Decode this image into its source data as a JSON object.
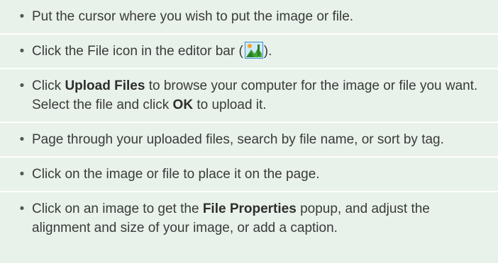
{
  "bullet_char": "•",
  "instructions": [
    {
      "text": "Put the cursor where you wish to put the image or file."
    },
    {
      "before": "Click the File icon in the editor bar (",
      "icon": "image-file-icon",
      "after": ")."
    },
    {
      "pre": "Click ",
      "bold1": "Upload Files",
      "mid": " to browse your computer for the image or file you want. Select the file and click ",
      "bold2": "OK",
      "post": " to upload it."
    },
    {
      "text": "Page through your uploaded files, search by file name, or sort by tag."
    },
    {
      "text": "Click on the image or file to place it on the page."
    },
    {
      "pre": "Click on an image to get the ",
      "bold": "File Properties",
      "post": " popup, and adjust the alignment and size of your image, or add a caption."
    }
  ],
  "colors": {
    "background": "#e8f2ea",
    "divider": "#ffffff",
    "icon_border": "#3a8fd0"
  }
}
